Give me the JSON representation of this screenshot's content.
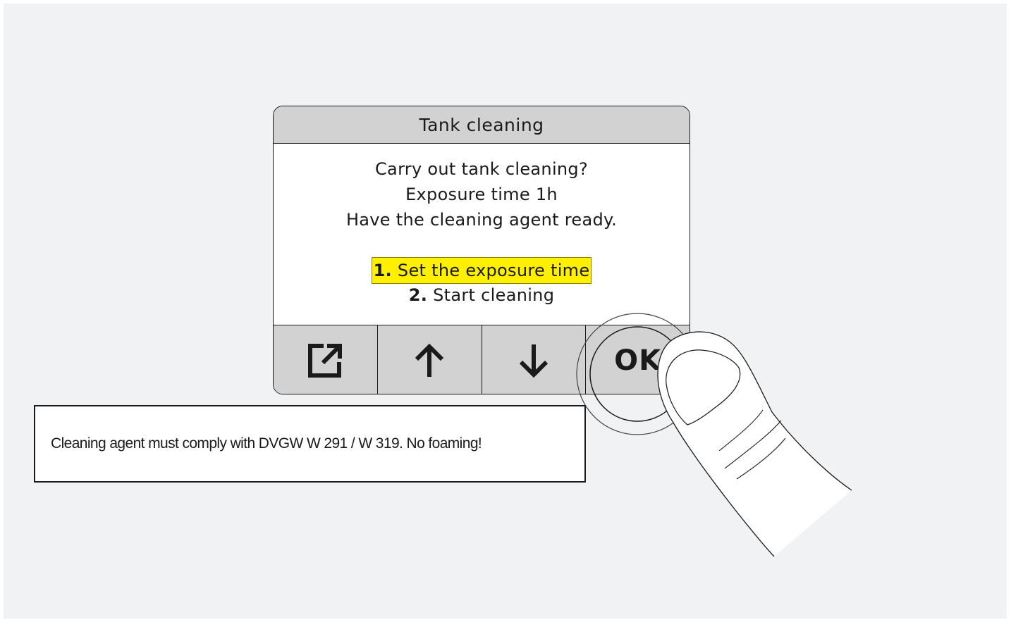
{
  "screen": {
    "title": "Tank cleaning",
    "message_lines": [
      "Carry out tank cleaning?",
      "Exposure time 1h",
      "Have the cleaning agent ready."
    ],
    "options": [
      {
        "number": "1.",
        "label": "Set the exposure time",
        "selected": true
      },
      {
        "number": "2.",
        "label": "Start cleaning",
        "selected": false
      }
    ],
    "highlight_color": "#ffef00"
  },
  "softkeys": {
    "exit_icon": "exit-icon",
    "up_icon": "arrow-up-icon",
    "down_icon": "arrow-down-icon",
    "ok_label": "OK"
  },
  "note": {
    "text": "Cleaning agent must comply with DVGW W 291 / W 319. No foaming!"
  },
  "illustration": {
    "pointer": "finger-press-icon",
    "target": "ok-button"
  }
}
